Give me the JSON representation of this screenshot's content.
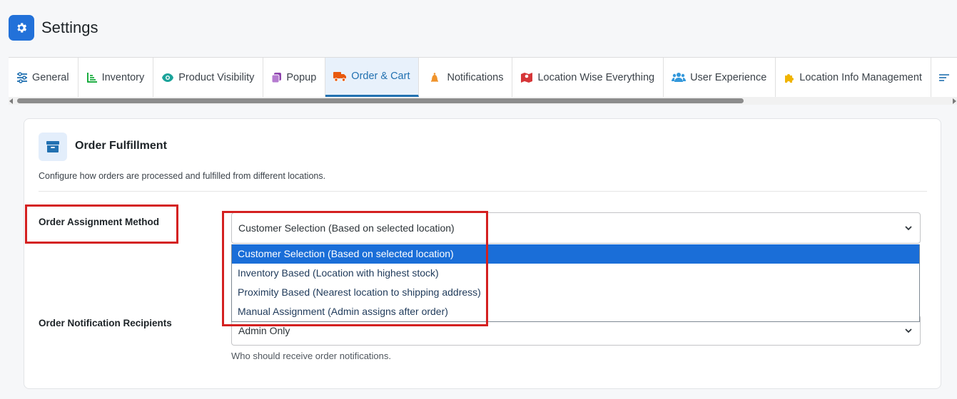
{
  "header": {
    "title": "Settings",
    "icon": "gear-icon",
    "accent": "#2271d9"
  },
  "tabs": [
    {
      "label": "General",
      "icon": "sliders-icon",
      "color": "#2271b1",
      "active": false
    },
    {
      "label": "Inventory",
      "icon": "chart-icon",
      "color": "#00a32a",
      "active": false
    },
    {
      "label": "Product Visibility",
      "icon": "eye-icon",
      "color": "#1aa39a",
      "active": false
    },
    {
      "label": "Popup",
      "icon": "copy-icon",
      "color": "#8e44ad",
      "active": false
    },
    {
      "label": "Order & Cart",
      "icon": "truck-icon",
      "color": "#e8590c",
      "active": true
    },
    {
      "label": "Notifications",
      "icon": "bell-icon",
      "color": "#f0932b",
      "active": false
    },
    {
      "label": "Location Wise Everything",
      "icon": "map-icon",
      "color": "#d63638",
      "active": false
    },
    {
      "label": "User Experience",
      "icon": "users-icon",
      "color": "#3498db",
      "active": false
    },
    {
      "label": "Location Info Management",
      "icon": "puzzle-icon",
      "color": "#f0b400",
      "active": false
    },
    {
      "label": "",
      "icon": "list-icon",
      "color": "#2271b1",
      "active": false
    }
  ],
  "card": {
    "title": "Order Fulfillment",
    "description": "Configure how orders are processed and fulfilled from different locations.",
    "icon": "archive-icon"
  },
  "fields": {
    "assignment": {
      "label": "Order Assignment Method",
      "value": "Customer Selection (Based on selected location)",
      "options": [
        "Customer Selection (Based on selected location)",
        "Inventory Based (Location with highest stock)",
        "Proximity Based (Nearest location to shipping address)",
        "Manual Assignment (Admin assigns after order)"
      ],
      "selected_index": 0
    },
    "recipients": {
      "label": "Order Notification Recipients",
      "value": "Admin Only",
      "help": "Who should receive order notifications."
    }
  },
  "colors": {
    "highlight": "#d42020",
    "selected_option": "#1a6ed8",
    "active_tab": "#2271b1"
  }
}
